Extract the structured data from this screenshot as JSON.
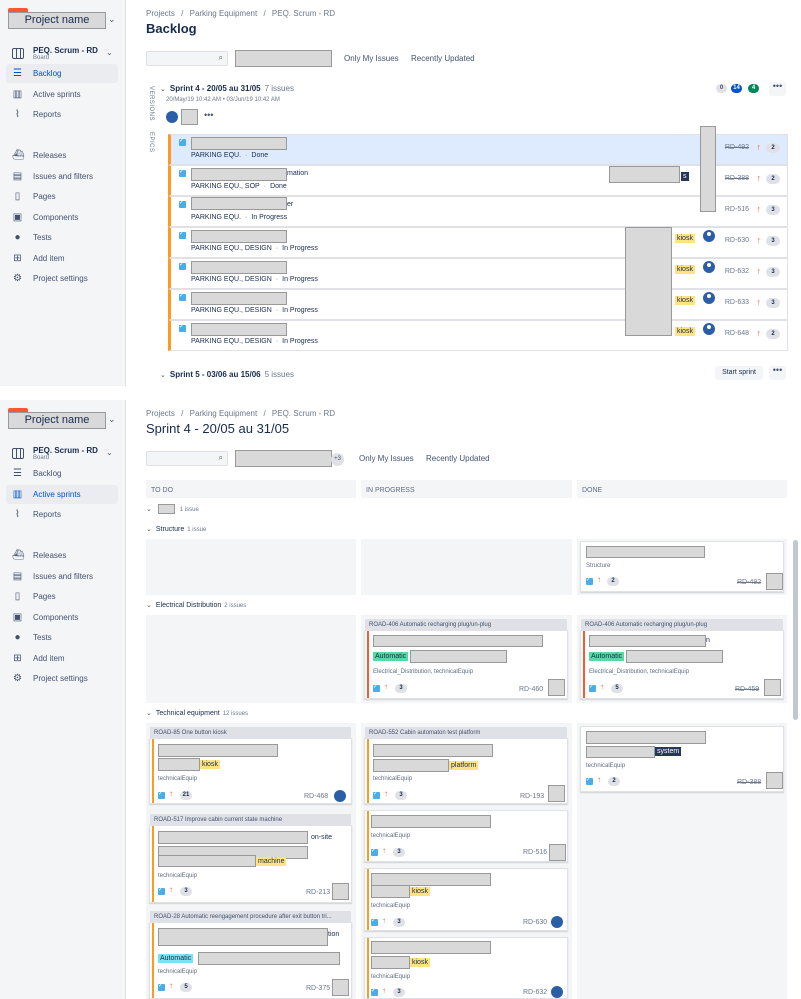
{
  "project_name": "Project name",
  "board": {
    "name": "PEQ. Scrum - RD",
    "type": "Board"
  },
  "nav": {
    "backlog": "Backlog",
    "active_sprints": "Active sprints",
    "reports": "Reports",
    "releases": "Releases",
    "issues_filters": "Issues and filters",
    "pages": "Pages",
    "components": "Components",
    "tests": "Tests",
    "add_item": "Add item",
    "project_settings": "Project settings"
  },
  "breadcrumb": {
    "projects": "Projects",
    "sep": "/",
    "parking": "Parking Equipment",
    "scrum": "PEQ. Scrum - RD"
  },
  "backlog": {
    "title": "Backlog",
    "only_my_issues": "Only My Issues",
    "recently_updated": "Recently Updated",
    "versions": "VERSIONS",
    "epics": "EPICS",
    "sprint4": {
      "name": "Sprint 4 - 20/05 au 31/05",
      "count": "7 issues",
      "dates": "20/May/19 10:42 AM  •  03/Jun/19 10:42 AM",
      "b0": "0",
      "b1": "14",
      "b2": "4"
    },
    "rows": [
      {
        "text": "",
        "meta": "PARKING EQU.",
        "status": "Done",
        "key": "RD-492",
        "est": "2",
        "label": ""
      },
      {
        "text": "mation",
        "meta": "PARKING EQU., SOP",
        "status": "Done",
        "key": "RD-388",
        "est": "2",
        "label": "s"
      },
      {
        "text": "er",
        "meta": "PARKING EQU.",
        "status": "In Progress",
        "key": "RD-516",
        "est": "3",
        "label": ""
      },
      {
        "text": "",
        "meta": "PARKING EQU., DESIGN",
        "status": "In Progress",
        "key": "RD-630",
        "est": "3",
        "label": "kiosk"
      },
      {
        "text": "",
        "meta": "PARKING EQU., DESIGN",
        "status": "In Progress",
        "key": "RD-632",
        "est": "3",
        "label": "kiosk"
      },
      {
        "text": "",
        "meta": "PARKING EQU., DESIGN",
        "status": "In Progress",
        "key": "RD-633",
        "est": "3",
        "label": "kiosk"
      },
      {
        "text": "",
        "meta": "PARKING EQU., DESIGN",
        "status": "In Progress",
        "key": "RD-648",
        "est": "2",
        "label": "kiosk"
      }
    ],
    "sprint5": {
      "name": "Sprint 5 - 03/06 au 15/06",
      "count": "5 issues",
      "start": "Start sprint"
    },
    "more": "•••"
  },
  "board_view": {
    "title": "Sprint 4 - 20/05 au 31/05",
    "plus": "+3",
    "only_my_issues": "Only My Issues",
    "recently_updated": "Recently Updated",
    "cols": {
      "todo": "TO DO",
      "inprogress": "IN PROGRESS",
      "done": "DONE"
    },
    "swim0": {
      "count": "1 issue"
    },
    "swim1": {
      "name": "Structure",
      "count": "1 issue"
    },
    "swim2": {
      "name": "Electrical Distribution",
      "count": "2 issues"
    },
    "swim3": {
      "name": "Technical equipment",
      "count": "12 issues"
    },
    "cards": {
      "s_done": {
        "comp": "Structure",
        "est": "2",
        "key": "RD-492"
      },
      "e_ip": {
        "epic": "ROAD-406 Automatic recharging plug/un-plug",
        "tag": "Automatic",
        "comp": "Electrical_Distribution, technicalEquip",
        "est": "3",
        "key": "RD-460"
      },
      "e_done": {
        "epic": "ROAD-406 Automatic recharging plug/un-plug",
        "text": "n",
        "tag": "Automatic",
        "comp": "Electrical_Distribution, technicalEquip",
        "est": "5",
        "key": "RD-459"
      },
      "t1": {
        "epic": "ROAD-85 One button kiosk",
        "tag": "kiosk",
        "comp": "technicalEquip",
        "est": "21",
        "key": "RD-468"
      },
      "t2": {
        "epic": "ROAD-517 Improve cabin current state machine",
        "text": "on-site",
        "tag": "machine",
        "comp": "technicalEquip",
        "est": "3",
        "key": "RD-213"
      },
      "t3": {
        "epic": "ROAD-28 Automatic reengagement procedure after exit button tri...",
        "text": "tion",
        "tag": "Automatic",
        "comp": "technicalEquip",
        "est": "5",
        "key": "RD-375"
      },
      "i1": {
        "epic": "ROAD-552 Cabin automaton test platform",
        "tag": "platform",
        "comp": "technicalEquip",
        "est": "3",
        "key": "RD-193"
      },
      "i2": {
        "comp": "technicalEquip",
        "est": "3",
        "key": "RD-516"
      },
      "i3": {
        "tag": "kiosk",
        "comp": "technicalEquip",
        "est": "3",
        "key": "RD-630"
      },
      "i4": {
        "tag": "kiosk",
        "comp": "technicalEquip",
        "est": "3",
        "key": "RD-632"
      },
      "d1": {
        "tag": "system",
        "comp": "technicalEquip",
        "est": "2",
        "key": "RD-388"
      }
    }
  }
}
